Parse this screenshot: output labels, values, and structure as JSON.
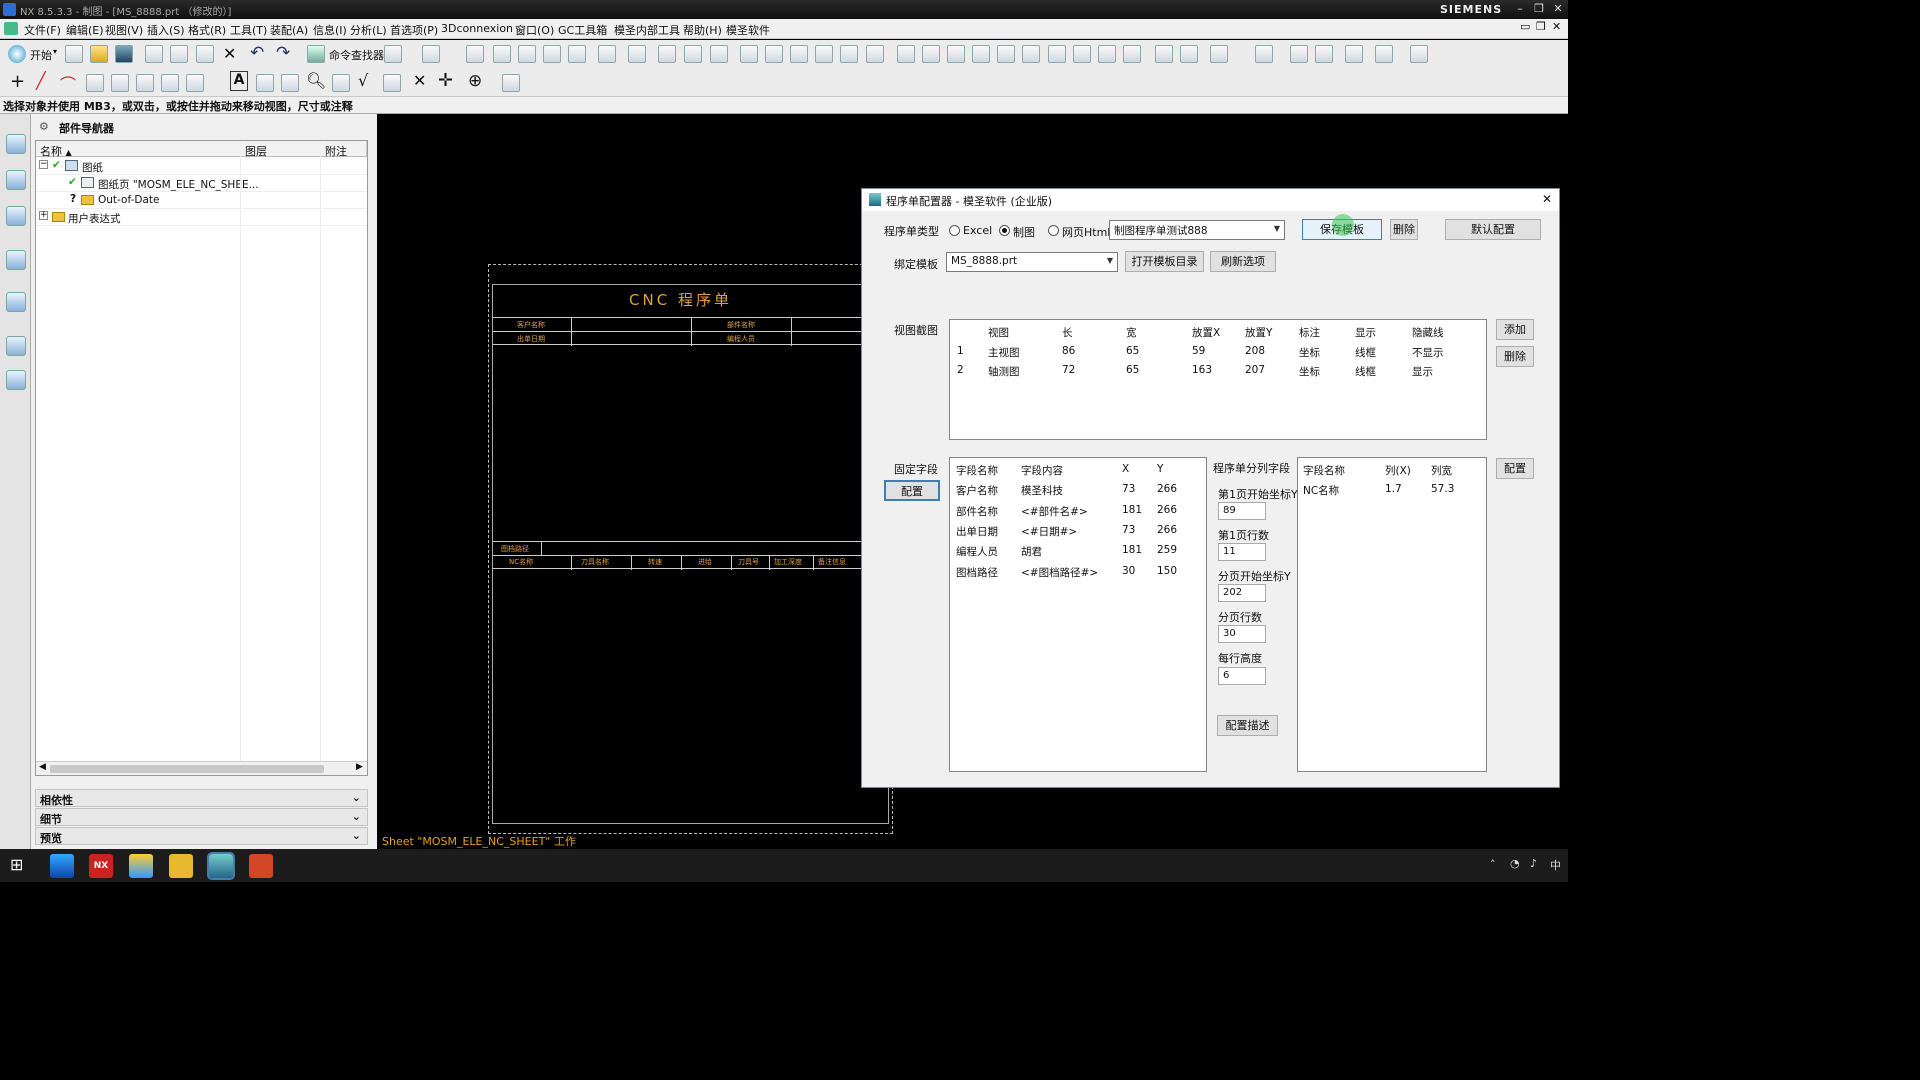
{
  "window": {
    "title": "NX 8.5.3.3 - 制图 - [MS_8888.prt （修改的）]",
    "brand": "SIEMENS"
  },
  "menu": [
    "文件(F)",
    "编辑(E)",
    "视图(V)",
    "插入(S)",
    "格式(R)",
    "工具(T)",
    "装配(A)",
    "信息(I)",
    "分析(L)",
    "首选项(P)",
    "3Dconnexion",
    "窗口(O)",
    "GC工具箱",
    "模圣内部工具",
    "帮助(H)",
    "模圣软件"
  ],
  "toolbar": {
    "start_label": "开始",
    "cmd_finder": "命令查找器"
  },
  "status_text": "选择对象并使用 MB3，或双击，或按住并拖动来移动视图，尺寸或注释",
  "navigator": {
    "title": "部件导航器",
    "columns": [
      "名称",
      "图层",
      "附注"
    ],
    "rows": [
      "图纸",
      "图纸页 \"MOSM_ELE_NC_SHEE...",
      "Out-of-Date",
      "用户表达式"
    ],
    "panels": [
      "相依性",
      "细节",
      "预览"
    ]
  },
  "drawing": {
    "title": "CNC 程序单",
    "header_cells": [
      "客户名称",
      "部件名称",
      "出单日期",
      "编程人员"
    ],
    "path_label": "图档路径",
    "nc_columns": [
      "NC名称",
      "刀具名称",
      "转速",
      "进给",
      "刀具号",
      "加工深度",
      "备注信息"
    ],
    "sheet_label": "Sheet \"MOSM_ELE_NC_SHEET\" 工作"
  },
  "dialog": {
    "title": "程序单配置器 - 模圣软件 (企业版)",
    "type_label": "程序单类型",
    "radio_options": [
      "Excel",
      "制图",
      "网页Html"
    ],
    "selected_type": "制图",
    "template_select": "制图程序单测试888",
    "save_template": "保存模板",
    "delete": "删除",
    "default_config": "默认配置",
    "bind_label": "绑定模板",
    "bind_select": "MS_8888.prt",
    "open_dir": "打开模板目录",
    "refresh": "刷新选项",
    "view_label": "视图截图",
    "view_columns": [
      "视图",
      "长",
      "宽",
      "放置X",
      "放置Y",
      "标注",
      "显示",
      "隐藏线"
    ],
    "view_rows": [
      [
        "1",
        "主视图",
        "86",
        "65",
        "59",
        "208",
        "坐标",
        "线框",
        "不显示"
      ],
      [
        "2",
        "轴测图",
        "72",
        "65",
        "163",
        "207",
        "坐标",
        "线框",
        "显示"
      ]
    ],
    "add": "添加",
    "view_delete": "删除",
    "fixed_label": "固定字段",
    "config": "配置",
    "fixed_columns": [
      "字段名称",
      "字段内容",
      "X",
      "Y"
    ],
    "fixed_rows": [
      [
        "客户名称",
        "模圣科技",
        "73",
        "266"
      ],
      [
        "部件名称",
        "<#部件名#>",
        "181",
        "266"
      ],
      [
        "出单日期",
        "<#日期#>",
        "73",
        "266"
      ],
      [
        "编程人员",
        "胡君",
        "181",
        "259"
      ],
      [
        "图档路径",
        "<#图档路径#>",
        "30",
        "150"
      ]
    ],
    "split_label": "程序单分列字段",
    "split_fields": [
      {
        "label": "第1页开始坐标Y",
        "value": "89"
      },
      {
        "label": "第1页行数",
        "value": "11"
      },
      {
        "label": "分页开始坐标Y",
        "value": "202"
      },
      {
        "label": "分页行数",
        "value": "30"
      },
      {
        "label": "每行高度",
        "value": "6"
      }
    ],
    "config_desc": "配置描述",
    "col_columns": [
      "字段名称",
      "列(X)",
      "列宽"
    ],
    "col_rows": [
      [
        "NC名称",
        "1.7",
        "57.3"
      ]
    ],
    "config2": "配置"
  },
  "taskbar": {
    "ime": "中"
  }
}
